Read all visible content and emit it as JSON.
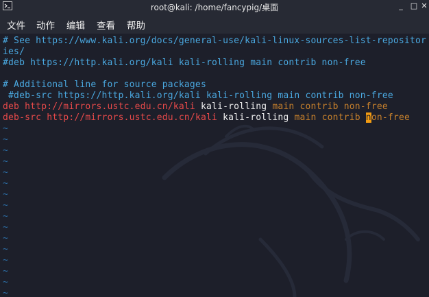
{
  "window": {
    "title": "root@kali: /home/fancypig/桌面",
    "minimize_label": "_",
    "maximize_label": "□",
    "close_label": "✕"
  },
  "menu": {
    "file": "文件",
    "action": "动作",
    "edit": "编辑",
    "view": "查看",
    "help": "帮助"
  },
  "editor": {
    "lines": [
      "# See https://www.kali.org/docs/general-use/kali-linux-sources-list-repositor",
      "ies/",
      "#deb https://http.kali.org/kali kali-rolling main contrib non-free",
      "",
      "# Additional line for source packages",
      " #deb-src https://http.kali.org/kali kali-rolling main contrib non-free"
    ],
    "deb_line": {
      "keyword": "deb",
      "url": "http://mirrors.ustc.edu.cn/kali",
      "suite": "kali-rolling",
      "components": "main contrib non-free"
    },
    "debsrc_line": {
      "keyword": "deb-src",
      "url": "http://mirrors.ustc.edu.cn/kali",
      "suite": "kali-rolling",
      "components_before": "main contrib ",
      "cursor_char": "n",
      "components_after": "on-free"
    },
    "tilde": "~"
  },
  "colors": {
    "background": "#1d1f2a",
    "comment": "#4aa8e0",
    "keyword": "#e84a4a",
    "url": "#e84a4a",
    "suite": "#f0f0f0",
    "components": "#c8812c",
    "cursor": "#f39c12",
    "tilde": "#2c6fa8"
  }
}
